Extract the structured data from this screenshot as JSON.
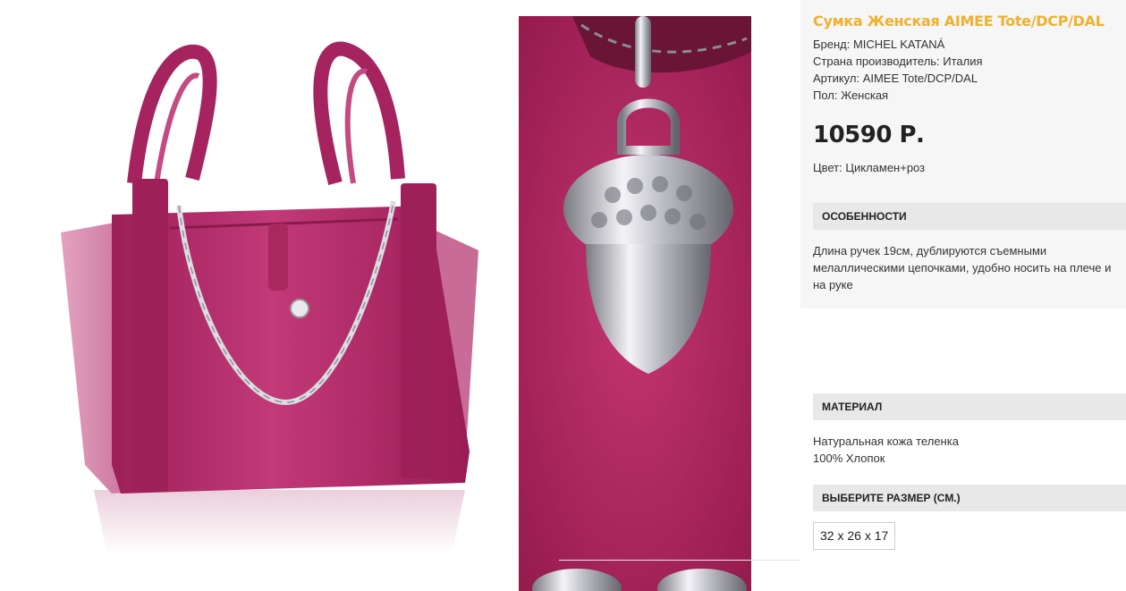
{
  "product": {
    "title": "Сумка Женская AIMEE Tote/DCP/DAL",
    "brand": "Бренд: MICHEL KATANÁ",
    "country": "Страна производитель: Италия",
    "article": "Артикул: AIMEE Tote/DCP/DAL",
    "gender": "Пол: Женская",
    "price": "10590 Р.",
    "color": "Цвет: Цикламен+роз"
  },
  "features": {
    "heading": "ОСОБЕННОСТИ",
    "lines": [
      "Длина ручек 19см, дублируются съемными",
      "мелаллическими цепочками, удобно носить на плече и",
      "на руке"
    ]
  },
  "material": {
    "heading": "МАТЕРИАЛ",
    "lines": [
      "Натуральная кожа теленка",
      "100% Хлопок"
    ]
  },
  "size": {
    "heading": "ВЫБЕРИТЕ РАЗМЕР (СМ.)",
    "selected": "32 x 26 x 17"
  },
  "colors": {
    "title": "#f0b030",
    "bag": "#b02a68",
    "bag_side": "#d27aa0",
    "leather_detail": "#b0245e",
    "section_bg": "#e8e8e8"
  }
}
